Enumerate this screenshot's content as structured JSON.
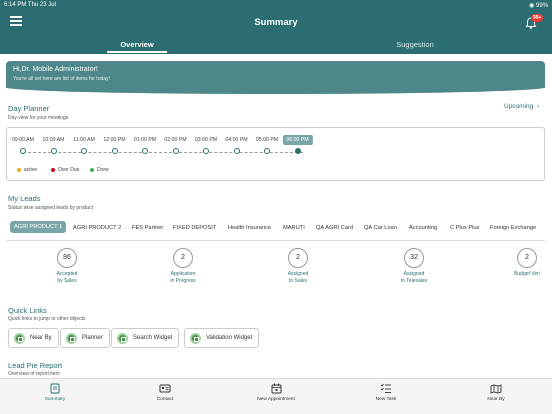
{
  "status_bar": {
    "time_date": "6:14 PM  Thu 23 Jul",
    "battery": "99%"
  },
  "header": {
    "title": "Summary",
    "notification_count": "99+"
  },
  "tabs": [
    {
      "label": "Overview",
      "active": true
    },
    {
      "label": "Suggestion",
      "active": false
    }
  ],
  "banner": {
    "greeting": "Hi,Dr. Mobile  Administrator!",
    "subtitle": "You're all set here are list of items for today!"
  },
  "day_planner": {
    "title": "Day Planner",
    "subtitle": "Day view for your meetings",
    "upcoming_label": "Upcoming",
    "times": [
      "09:00 AM",
      "10:00 AM",
      "11:00 AM",
      "12:00 PM",
      "01:00 PM",
      "02:00 PM",
      "03:00 PM",
      "04:00 PM",
      "05:00 PM",
      "06:00 PM"
    ],
    "current_time_index": 9,
    "legend": [
      {
        "label": "active",
        "color": "#f5a623"
      },
      {
        "label": "Over Due",
        "color": "#d0021b"
      },
      {
        "label": "Done",
        "color": "#4caf50"
      }
    ]
  },
  "my_leads": {
    "title": "My Leads",
    "subtitle": "Status wise assigned leads by product",
    "products": [
      "AGRI PRODUCT 1",
      "AGRI PRODUCT 2",
      "FES Partner",
      "FIXED DEPOSIT",
      "Health Insurance",
      "MARUTI",
      "QA AGRI Card",
      "QA Car Loan",
      "Accounting",
      "C Plus Plus",
      "Foreign Exchange"
    ],
    "active_product_index": 0,
    "metrics": [
      {
        "value": "86",
        "label_line1": "Accepted",
        "label_line2": "by Sales"
      },
      {
        "value": "2",
        "label_line1": "Application",
        "label_line2": "in Progress"
      },
      {
        "value": "2",
        "label_line1": "Assigned",
        "label_line2": "to Sales"
      },
      {
        "value": "32",
        "label_line1": "Assigned",
        "label_line2": "to Telesales"
      },
      {
        "value": "2",
        "label_line1": "Budget Veri",
        "label_line2": ""
      }
    ]
  },
  "quick_links": {
    "title": "Quick Links",
    "subtitle": "Quick links to jump to other objects",
    "items": [
      "Near By",
      "Planner",
      "Search Widget",
      "Validation Widget"
    ]
  },
  "lead_pie_report": {
    "title": "Lead Pie Report",
    "subtitle": "Overview of report item"
  },
  "bottom_nav": [
    {
      "label": "Summary",
      "icon": "summary-icon",
      "active": true
    },
    {
      "label": "Contact",
      "icon": "contact-card-icon",
      "active": false
    },
    {
      "label": "New Appointment",
      "icon": "calendar-icon",
      "active": false
    },
    {
      "label": "New Task",
      "icon": "task-list-icon",
      "active": false
    },
    {
      "label": "Near By",
      "icon": "map-icon",
      "active": false
    }
  ],
  "colors": {
    "primary": "#2b6d71",
    "banner": "#4d878a",
    "highlight": "#79a7a9"
  }
}
